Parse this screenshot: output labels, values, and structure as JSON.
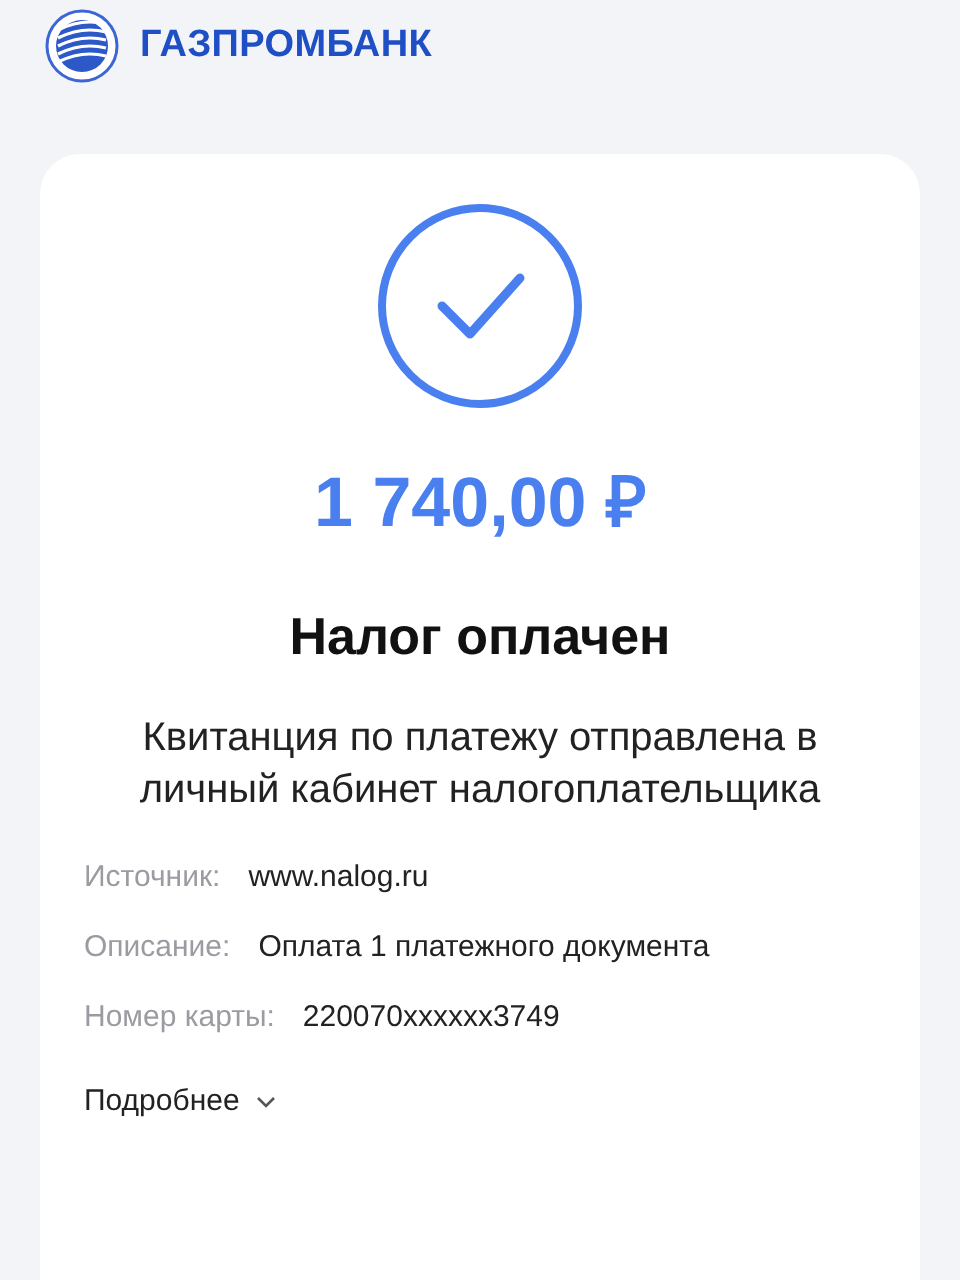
{
  "header": {
    "bank_name": "ГАЗПРОМБАНК"
  },
  "receipt": {
    "amount": "1 740,00 ₽",
    "title": "Налог оплачен",
    "message": "Квитанция по платежу отправлена в личный кабинет налогоплательщика",
    "details": [
      {
        "label": "Источник:",
        "value": "www.nalog.ru"
      },
      {
        "label": "Описание:",
        "value": "Оплата 1 платежного документа"
      },
      {
        "label": "Номер карты:",
        "value": "220070xxxxxx3749"
      }
    ],
    "more": {
      "label": "Подробнее",
      "expanded": false
    }
  }
}
